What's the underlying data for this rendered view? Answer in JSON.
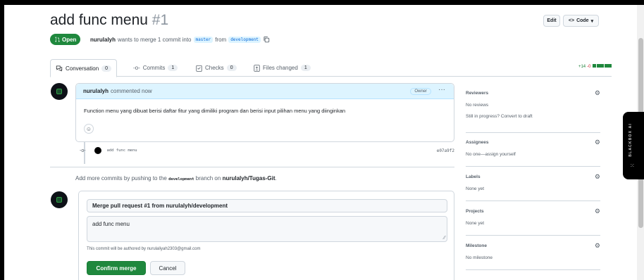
{
  "pr": {
    "title": "add func menu",
    "number": "#1",
    "status": "Open",
    "author": "nurulalyh",
    "meta_text": "wants to merge 1 commit into",
    "base_branch": "master",
    "from_text": "from",
    "head_branch": "development"
  },
  "header": {
    "edit_label": "Edit",
    "code_label": "Code"
  },
  "tabs": [
    {
      "label": "Conversation",
      "count": "0"
    },
    {
      "label": "Commits",
      "count": "1"
    },
    {
      "label": "Checks",
      "count": "0"
    },
    {
      "label": "Files changed",
      "count": "1"
    }
  ],
  "diffstat": {
    "additions": "+14",
    "deletions": "-0"
  },
  "comment": {
    "author": "nurulalyh",
    "action": "commented now",
    "badge": "Owner",
    "body": "Function menu yang dibuat berisi daftar fitur yang dimiliki program dan berisi input pilihan menu yang diinginkan"
  },
  "commit": {
    "message": "add func menu",
    "sha": "e07a9f2"
  },
  "add_more": {
    "prefix": "Add more commits by pushing to the",
    "branch": "development",
    "middle": "branch on",
    "repo": "nurulalyh/Tugas-Git",
    "suffix": "."
  },
  "merge": {
    "title": "Merge pull request #1 from nurulalyh/development",
    "message": "add func menu",
    "author_note": "This commit will be authored by nurulaliyah2303@gmail.com",
    "confirm_label": "Confirm merge",
    "cancel_label": "Cancel"
  },
  "sidebar": {
    "reviewers": {
      "title": "Reviewers",
      "value": "No reviews",
      "progress_prefix": "Still in progress?",
      "progress_link": "Convert to draft"
    },
    "assignees": {
      "title": "Assignees",
      "value_prefix": "No one—",
      "value_link": "assign yourself"
    },
    "labels": {
      "title": "Labels",
      "value": "None yet"
    },
    "projects": {
      "title": "Projects",
      "value": "None yet"
    },
    "milestone": {
      "title": "Milestone",
      "value": "No milestone"
    }
  },
  "extension": {
    "label": "BLACKBOX AI"
  },
  "colors": {
    "accent_green": "#1f883d",
    "link_blue": "#0969da",
    "comment_header": "#ddf4ff"
  }
}
